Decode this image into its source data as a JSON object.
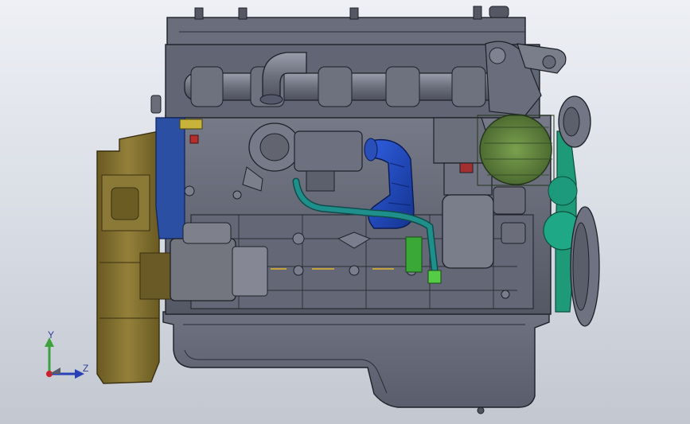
{
  "triad": {
    "y_label": "Y",
    "z_label": "Z"
  },
  "colors": {
    "background": "#d9dce3",
    "block": "#5f6270",
    "edge": "#1e2028",
    "flywheel_housing": "#7c6a2b",
    "intake_pipe": "#1e44b4",
    "coolant_hose": "#1f8f8c",
    "alternator": "#5c7f3c",
    "belt": "#1f9a78",
    "oil_line": "#3fbf3a",
    "axis_y": "#3da23d",
    "axis_z": "#2940b6",
    "origin": "#d01f2c"
  },
  "icons": {
    "triad": "coordinate-triad-icon"
  }
}
